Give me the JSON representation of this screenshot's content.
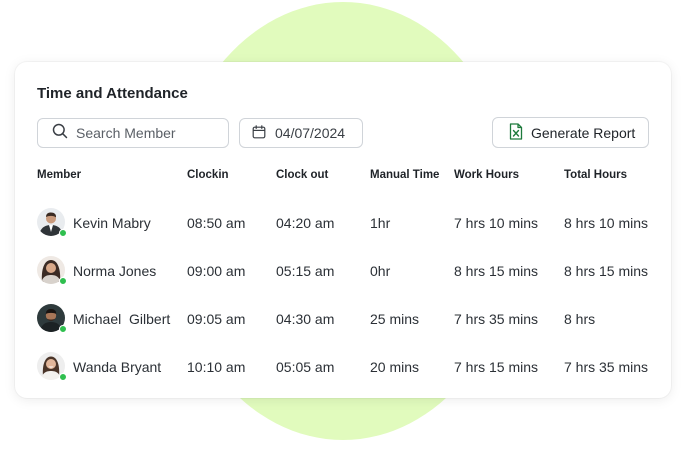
{
  "card": {
    "title": "Time and Attendance"
  },
  "toolbar": {
    "search_placeholder": "Search Member",
    "search_icon": "search-icon",
    "date_value": "04/07/2024",
    "date_icon": "calendar-icon",
    "report_label": "Generate Report",
    "report_icon": "excel-file-icon"
  },
  "table": {
    "headers": [
      "Member",
      "Clockin",
      "Clock out",
      "Manual Time",
      "Work Hours",
      "Total Hours"
    ],
    "rows": [
      {
        "member": "Kevin Mabry",
        "clockin": "08:50 am",
        "clockout": "04:20 am",
        "manual": "1hr",
        "work": "7 hrs 10 mins",
        "total": "8 hrs 10 mins",
        "status": "online"
      },
      {
        "member": "Norma Jones",
        "clockin": "09:00 am",
        "clockout": "05:15 am",
        "manual": "0hr",
        "work": "8 hrs 15 mins",
        "total": "8 hrs 15 mins",
        "status": "online"
      },
      {
        "member": "Michael  Gilbert",
        "clockin": "09:05 am",
        "clockout": "04:30 am",
        "manual": "25 mins",
        "work": "7 hrs 35 mins",
        "total": "8 hrs",
        "status": "online"
      },
      {
        "member": "Wanda Bryant",
        "clockin": "10:10 am",
        "clockout": "05:05 am",
        "manual": "20 mins",
        "work": "7 hrs 15 mins",
        "total": "7 hrs 35 mins",
        "status": "online"
      }
    ]
  },
  "colors": {
    "background_blob": "#e1fbbd",
    "online": "#2fbf4f",
    "excel_green": "#1e7a3c"
  }
}
